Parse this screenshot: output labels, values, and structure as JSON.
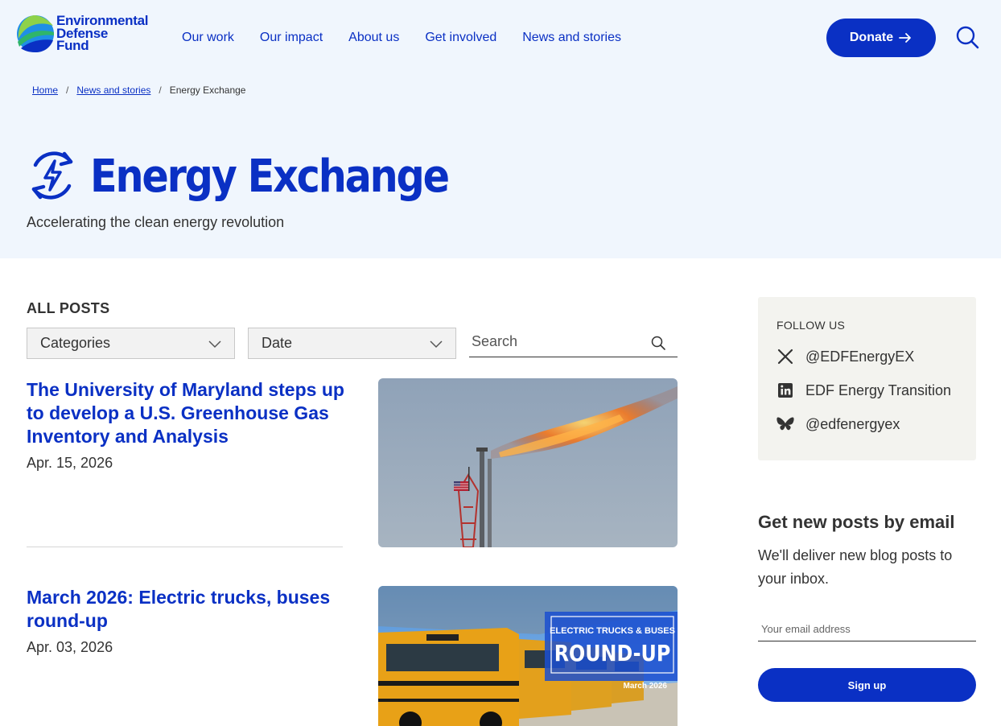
{
  "brand": {
    "name_line1": "Environmental",
    "name_line2": "Defense",
    "name_line3": "Fund",
    "primary_color": "#0a30c4",
    "hero_bg": "#f0f6fd"
  },
  "nav": {
    "items": [
      {
        "label": "Our work"
      },
      {
        "label": "Our impact"
      },
      {
        "label": "About us"
      },
      {
        "label": "Get involved"
      },
      {
        "label": "News and stories"
      }
    ],
    "donate_label": "Donate",
    "donate_icon": "arrow-right-icon",
    "search_icon": "search-icon"
  },
  "breadcrumb": {
    "items": [
      {
        "label": "Home"
      },
      {
        "label": "News and stories"
      },
      {
        "label": "Energy Exchange"
      }
    ],
    "separator": "/"
  },
  "hero": {
    "icon": "energy-cycle-icon",
    "title": "Energy Exchange",
    "subtitle": "Accelerating the clean energy revolution"
  },
  "filters": {
    "section_label": "ALL POSTS",
    "categories_label": "Categories",
    "date_label": "Date",
    "search_placeholder": "Search"
  },
  "posts": [
    {
      "title": "The University of Maryland steps up to develop a U.S. Greenhouse Gas Inventory and Analysis",
      "date": "Apr. 15, 2026",
      "image": "gas-flare-photo"
    },
    {
      "title": "March 2026: Electric trucks, buses round-up",
      "date": "Apr. 03, 2026",
      "image": "school-buses-photo",
      "image_badge_line1": "ELECTRIC TRUCKS & BUSES",
      "image_badge_line2": "ROUND-UP",
      "image_badge_date": "March 2026"
    }
  ],
  "sidebar": {
    "follow_label": "FOLLOW US",
    "social": [
      {
        "icon": "x-icon",
        "label": "@EDFEnergyEX"
      },
      {
        "icon": "linkedin-icon",
        "label": "EDF Energy Transition"
      },
      {
        "icon": "bluesky-icon",
        "label": "@edfenergyex"
      }
    ],
    "email_title": "Get new posts by email",
    "email_desc": "We'll deliver new blog posts to your inbox.",
    "email_placeholder": "Your email address",
    "signup_label": "Sign up"
  }
}
